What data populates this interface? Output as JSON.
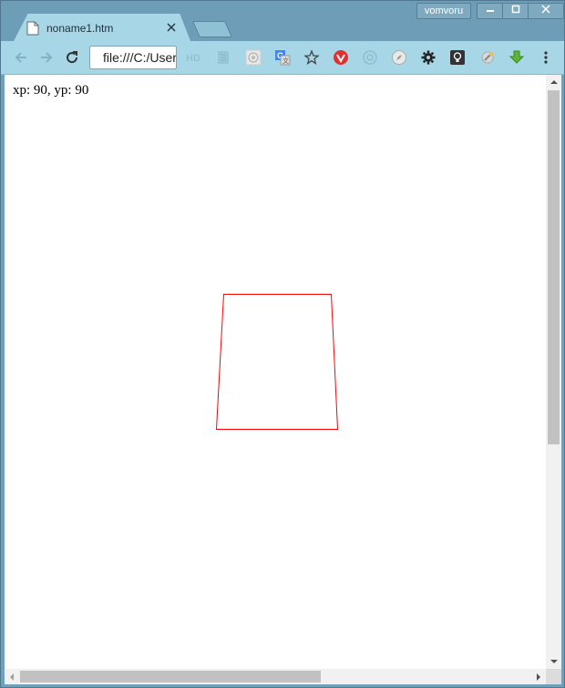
{
  "window": {
    "profile_name": "vomvoru",
    "controls": {
      "minimize": "—",
      "maximize": "▢",
      "close": "X"
    }
  },
  "tabs": [
    {
      "title": "noname1.htm",
      "close": "×",
      "active": true
    }
  ],
  "toolbar": {
    "address": "file:///C:/Users",
    "extensions": [
      "hd-icon",
      "list-icon",
      "network-icon",
      "translate-icon",
      "bookmark-star-icon",
      "vivaldi-icon",
      "at-icon",
      "compass-icon",
      "gear-icon",
      "lightbulb-icon",
      "settings-sparkle-icon",
      "download-icon",
      "more-menu-icon"
    ]
  },
  "page": {
    "coords_text": "xp: 90, yp: 90"
  },
  "canvas": {
    "shape": "quadrilateral",
    "stroke": "#ff0000"
  },
  "colors": {
    "titlebar": "#6d9db7",
    "toolbar": "#a7d7e6",
    "shape_stroke": "#ff0000"
  }
}
